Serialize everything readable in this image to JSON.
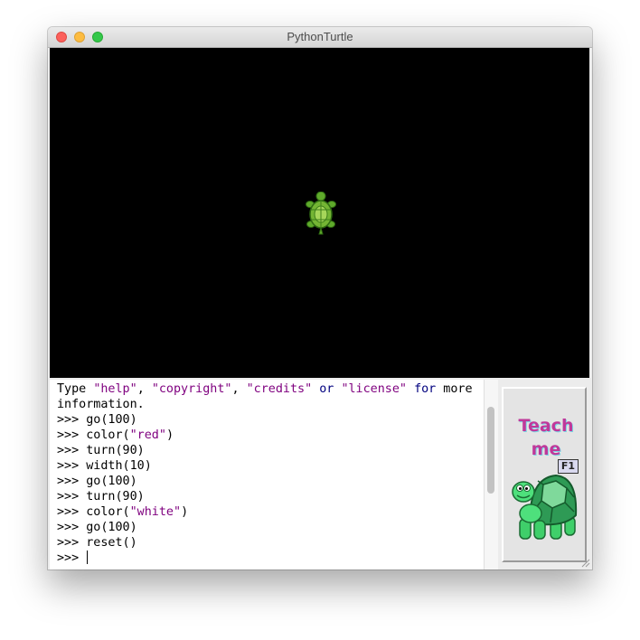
{
  "window": {
    "title": "PythonTurtle"
  },
  "shell": {
    "banner": {
      "word_type": "Type ",
      "help": "\"help\"",
      "comma1": ", ",
      "copyright": "\"copyright\"",
      "comma2": ", ",
      "credits": "\"credits\"",
      "or_word": "or",
      "license": "\"license\"",
      "for_word": "for",
      "more": " more",
      "line2": "information."
    },
    "prompt": ">>> ",
    "history": [
      {
        "code": "go(100)"
      },
      {
        "code_pre": "color(",
        "string": "\"red\"",
        "code_post": ")"
      },
      {
        "code": "turn(90)"
      },
      {
        "code": "width(10)"
      },
      {
        "code": "go(100)"
      },
      {
        "code": "turn(90)"
      },
      {
        "code_pre": "color(",
        "string": "\"white\"",
        "code_post": ")"
      },
      {
        "code": "go(100)"
      },
      {
        "code": "reset()"
      }
    ],
    "current_input": ""
  },
  "teach_me": {
    "line1": "Teach",
    "line2": "me",
    "shortcut": "F1"
  },
  "colors": {
    "canvas_background": "#000000",
    "string_literal": "#7f007f",
    "keyword": "#00007f",
    "teach_text": "#c0389a",
    "turtle_green": "#5faa2b"
  },
  "icons": {
    "canvas_turtle": "turtle-icon",
    "teach_mascot": "turtle-mascot-icon"
  }
}
